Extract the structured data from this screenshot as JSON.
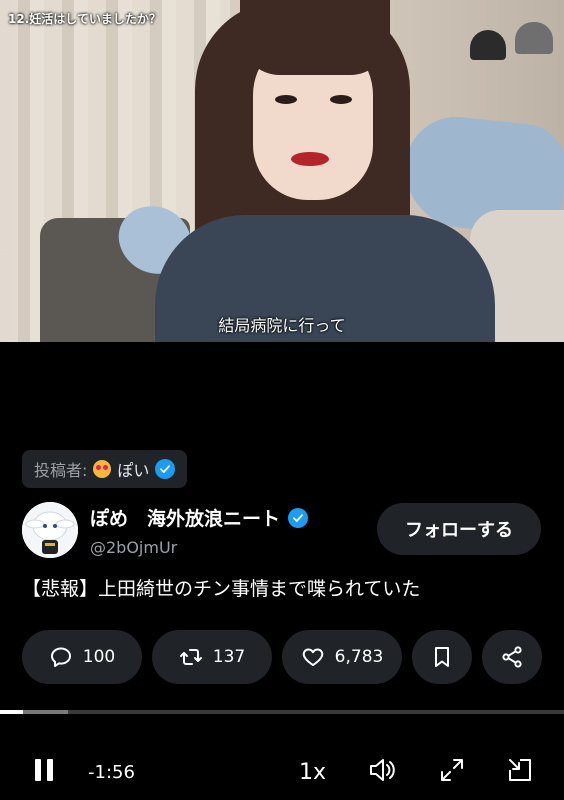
{
  "video": {
    "top_caption": "12.妊活はしていましたか？",
    "subtitle": "結局病院に行って"
  },
  "posted_by": {
    "label": "投稿者:",
    "name": "ぽい"
  },
  "author": {
    "display_name": "ぽめ　海外放浪ニート",
    "handle": "@2bOjmUr",
    "follow_label": "フォローする"
  },
  "tweet": {
    "text": "【悲報】上田綺世のチン事情まで喋られていた"
  },
  "actions": {
    "replies": "100",
    "retweets": "137",
    "likes": "6,783"
  },
  "player": {
    "time_remaining": "-1:56",
    "speed": "1x",
    "progress_played": 0.04,
    "progress_buffered": 0.12
  },
  "colors": {
    "verified": "#1d9bf0",
    "pill_bg": "#202327"
  }
}
